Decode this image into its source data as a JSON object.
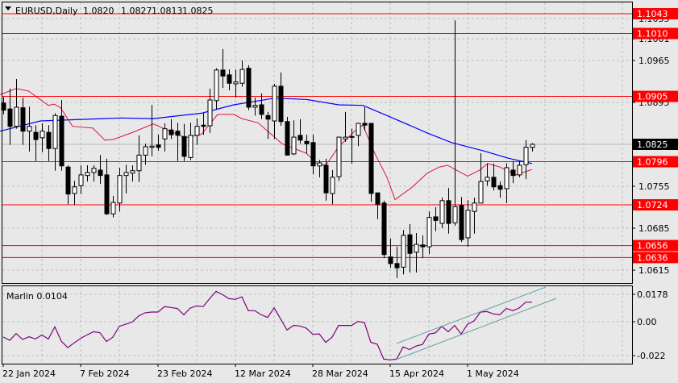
{
  "header": {
    "symbol_label": "EURUSD,Daily",
    "open": "1.0820",
    "high": "1.0827",
    "low": "1.0813",
    "close": "1.0825"
  },
  "indicator": {
    "name_label": "Marlin 0.0104",
    "axis_ticks": [
      "0.0178",
      "0.00",
      "-0.022"
    ]
  },
  "colors": {
    "background": "#e8e8e8",
    "level": "#ff0000",
    "ma_slow": "#0000ff",
    "ma_fast": "#e0143c",
    "marlin": "#800080",
    "channel": "#5f9ea0"
  },
  "price_axis": {
    "ticks": [
      "1.1035",
      "1.1001",
      "1.0965",
      "1.0895",
      "1.0825",
      "1.0755",
      "1.0685",
      "1.0615"
    ],
    "current_price": "1.0825"
  },
  "levels": [
    "1.1043",
    "1.1010",
    "1.0905",
    "1.0796",
    "1.0724",
    "1.0656",
    "1.0636"
  ],
  "date_axis": [
    {
      "label": "22 Jan 2024",
      "bar": 1
    },
    {
      "label": "7 Feb 2024",
      "bar": 13
    },
    {
      "label": "23 Feb 2024",
      "bar": 25
    },
    {
      "label": "12 Mar 2024",
      "bar": 37
    },
    {
      "label": "28 Mar 2024",
      "bar": 49
    },
    {
      "label": "15 Apr 2024",
      "bar": 61
    },
    {
      "label": "1 May 2024",
      "bar": 73
    }
  ],
  "chart_data": {
    "type": "candlestick",
    "symbol": "EURUSD",
    "timeframe": "Daily",
    "ylim": [
      1.0595,
      1.106
    ],
    "ohlc": [
      [
        1.0894,
        1.0904,
        1.0875,
        1.0882
      ],
      [
        1.0884,
        1.0918,
        1.0824,
        1.0855
      ],
      [
        1.0855,
        1.0934,
        1.0851,
        1.0887
      ],
      [
        1.0886,
        1.0903,
        1.0824,
        1.0847
      ],
      [
        1.0847,
        1.0888,
        1.0813,
        1.0855
      ],
      [
        1.0845,
        1.0857,
        1.0797,
        1.0833
      ],
      [
        1.0836,
        1.086,
        1.0812,
        1.0847
      ],
      [
        1.0845,
        1.0857,
        1.0797,
        1.0818
      ],
      [
        1.0818,
        1.0877,
        1.0781,
        1.0873
      ],
      [
        1.0872,
        1.0899,
        1.0781,
        1.0789
      ],
      [
        1.0787,
        1.079,
        1.0725,
        1.0742
      ],
      [
        1.0743,
        1.0764,
        1.0724,
        1.0754
      ],
      [
        1.0756,
        1.079,
        1.0742,
        1.0774
      ],
      [
        1.0773,
        1.079,
        1.0763,
        1.0778
      ],
      [
        1.0778,
        1.079,
        1.0763,
        1.0785
      ],
      [
        1.0782,
        1.0807,
        1.0759,
        1.0773
      ],
      [
        1.0774,
        1.0801,
        1.0707,
        1.0709
      ],
      [
        1.0709,
        1.0739,
        1.0703,
        1.0728
      ],
      [
        1.0727,
        1.0786,
        1.0713,
        1.0773
      ],
      [
        1.0773,
        1.0791,
        1.0743,
        1.0778
      ],
      [
        1.0777,
        1.079,
        1.0763,
        1.0781
      ],
      [
        1.0781,
        1.084,
        1.0762,
        1.0807
      ],
      [
        1.0807,
        1.0826,
        1.0791,
        1.0821
      ],
      [
        1.082,
        1.0891,
        1.0805,
        1.0822
      ],
      [
        1.0824,
        1.0841,
        1.0814,
        1.082
      ],
      [
        1.0834,
        1.086,
        1.0813,
        1.0851
      ],
      [
        1.0849,
        1.0867,
        1.0834,
        1.0841
      ],
      [
        1.0847,
        1.0861,
        1.0797,
        1.084
      ],
      [
        1.0838,
        1.0859,
        1.0797,
        1.0805
      ],
      [
        1.0803,
        1.0861,
        1.0799,
        1.084
      ],
      [
        1.084,
        1.0868,
        1.0824,
        1.0855
      ],
      [
        1.0857,
        1.0877,
        1.0841,
        1.0855
      ],
      [
        1.0856,
        1.0918,
        1.0844,
        1.0899
      ],
      [
        1.0898,
        1.0952,
        1.0883,
        1.0949
      ],
      [
        1.0949,
        1.0984,
        1.0919,
        1.0939
      ],
      [
        1.0941,
        1.095,
        1.0915,
        1.0927
      ],
      [
        1.0926,
        1.095,
        1.0903,
        1.0929
      ],
      [
        1.0927,
        1.0965,
        1.0921,
        1.095
      ],
      [
        1.0952,
        1.0957,
        1.0882,
        1.0887
      ],
      [
        1.0887,
        1.0903,
        1.0873,
        1.089
      ],
      [
        1.0891,
        1.091,
        1.0867,
        1.0875
      ],
      [
        1.0873,
        1.0879,
        1.0834,
        1.0867
      ],
      [
        1.0864,
        1.0926,
        1.0834,
        1.0922
      ],
      [
        1.0922,
        1.0945,
        1.0856,
        1.0863
      ],
      [
        1.0863,
        1.0871,
        1.0807,
        1.0807
      ],
      [
        1.0809,
        1.0865,
        1.0807,
        1.0837
      ],
      [
        1.084,
        1.0867,
        1.0826,
        1.0832
      ],
      [
        1.083,
        1.0841,
        1.081,
        1.0826
      ],
      [
        1.0828,
        1.0841,
        1.0775,
        1.0789
      ],
      [
        1.0789,
        1.0799,
        1.077,
        1.0794
      ],
      [
        1.079,
        1.0801,
        1.0731,
        1.0744
      ],
      [
        1.0743,
        1.0782,
        1.0725,
        1.077
      ],
      [
        1.0771,
        1.0838,
        1.0764,
        1.0837
      ],
      [
        1.0834,
        1.0879,
        1.0829,
        1.0837
      ],
      [
        1.0837,
        1.0851,
        1.0793,
        1.0838
      ],
      [
        1.084,
        1.0861,
        1.0822,
        1.086
      ],
      [
        1.086,
        1.0887,
        1.0848,
        1.0857
      ],
      [
        1.086,
        1.086,
        1.0729,
        1.0743
      ],
      [
        1.0744,
        1.0744,
        1.07,
        1.0725
      ],
      [
        1.0727,
        1.0731,
        1.0635,
        1.0641
      ],
      [
        1.0637,
        1.0668,
        1.0619,
        1.0626
      ],
      [
        1.0626,
        1.0654,
        1.0602,
        1.0619
      ],
      [
        1.062,
        1.0682,
        1.0608,
        1.0673
      ],
      [
        1.0674,
        1.0692,
        1.0611,
        1.0643
      ],
      [
        1.0645,
        1.0677,
        1.0611,
        1.0658
      ],
      [
        1.0657,
        1.0673,
        1.0635,
        1.0654
      ],
      [
        1.0654,
        1.0713,
        1.0642,
        1.0703
      ],
      [
        1.0704,
        1.072,
        1.068,
        1.0698
      ],
      [
        1.0693,
        1.0736,
        1.0685,
        1.0731
      ],
      [
        1.0731,
        1.0752,
        1.0676,
        1.0693
      ],
      [
        1.0694,
        1.1032,
        1.0689,
        1.0721
      ],
      [
        1.0723,
        1.0737,
        1.0662,
        1.0666
      ],
      [
        1.0669,
        1.0732,
        1.0654,
        1.0715
      ],
      [
        1.0713,
        1.0736,
        1.0676,
        1.0727
      ],
      [
        1.0727,
        1.081,
        1.0727,
        1.0763
      ],
      [
        1.0764,
        1.0793,
        1.0756,
        1.077
      ],
      [
        1.077,
        1.0793,
        1.0748,
        1.0754
      ],
      [
        1.0756,
        1.0763,
        1.0736,
        1.075
      ],
      [
        1.0751,
        1.0793,
        1.0727,
        1.0786
      ],
      [
        1.0782,
        1.0797,
        1.076,
        1.0773
      ],
      [
        1.0774,
        1.0797,
        1.077,
        1.079
      ],
      [
        1.0791,
        1.0832,
        1.0767,
        1.082
      ],
      [
        1.082,
        1.0827,
        1.0813,
        1.0825
      ]
    ],
    "ma_slow": [
      [
        0.5,
        1.0847
      ],
      [
        6.75,
        1.0864
      ],
      [
        19.25,
        1.0869
      ],
      [
        24.25,
        1.0868
      ],
      [
        31.75,
        1.0877
      ],
      [
        36.75,
        1.0891
      ],
      [
        43,
        1.0902
      ],
      [
        48,
        1.09
      ],
      [
        53,
        1.0891
      ],
      [
        56.75,
        1.089
      ],
      [
        60.5,
        1.0873
      ],
      [
        66.75,
        1.0844
      ],
      [
        70.5,
        1.0828
      ],
      [
        75.5,
        1.0814
      ],
      [
        79.25,
        1.0802
      ],
      [
        83,
        1.0793
      ]
    ],
    "ma_fast": [
      [
        0.5,
        1.0908
      ],
      [
        3,
        1.0918
      ],
      [
        4.9,
        1.0914
      ],
      [
        8,
        1.089
      ],
      [
        8.9,
        1.0892
      ],
      [
        9.9,
        1.0886
      ],
      [
        11.75,
        1.0855
      ],
      [
        14.9,
        1.0852
      ],
      [
        16.75,
        1.0832
      ],
      [
        18,
        1.0833
      ],
      [
        21.1,
        1.0845
      ],
      [
        24.25,
        1.0859
      ],
      [
        29.25,
        1.0836
      ],
      [
        31.75,
        1.0842
      ],
      [
        34.25,
        1.0875
      ],
      [
        36.75,
        1.0875
      ],
      [
        38,
        1.0868
      ],
      [
        40.5,
        1.0861
      ],
      [
        44.25,
        1.0826
      ],
      [
        48,
        1.081
      ],
      [
        49.9,
        1.079
      ],
      [
        51.1,
        1.0791
      ],
      [
        53,
        1.0821
      ],
      [
        55.5,
        1.0847
      ],
      [
        56.75,
        1.0857
      ],
      [
        58.6,
        1.081
      ],
      [
        60.5,
        1.077
      ],
      [
        61.75,
        1.0733
      ],
      [
        64.25,
        1.0752
      ],
      [
        66.75,
        1.0777
      ],
      [
        68.6,
        1.0787
      ],
      [
        69.9,
        1.079
      ],
      [
        71.75,
        1.0779
      ],
      [
        73,
        1.0772
      ],
      [
        74.9,
        1.0782
      ],
      [
        76.1,
        1.0793
      ],
      [
        78,
        1.0787
      ],
      [
        80.5,
        1.0774
      ],
      [
        83,
        1.0783
      ]
    ],
    "marlin": {
      "ylim": [
        -0.026,
        0.0215
      ],
      "values": [
        -0.0099,
        -0.0121,
        -0.0077,
        -0.0115,
        -0.0098,
        -0.0112,
        -0.0086,
        -0.0112,
        -0.0033,
        -0.0126,
        -0.0168,
        -0.0138,
        -0.0108,
        -0.0086,
        -0.0065,
        -0.0072,
        -0.0129,
        -0.01,
        -0.003,
        -0.0016,
        -0.0002,
        0.0037,
        0.0058,
        0.0063,
        0.0063,
        0.0098,
        0.0093,
        0.0086,
        0.0045,
        0.0089,
        0.0103,
        0.0098,
        0.015,
        0.0197,
        0.0176,
        0.015,
        0.0145,
        0.0162,
        0.0072,
        0.0072,
        0.0045,
        0.0028,
        0.009,
        0.0019,
        -0.0054,
        -0.0024,
        -0.0028,
        -0.0042,
        -0.0082,
        -0.0079,
        -0.0134,
        -0.01,
        -0.0024,
        -0.0024,
        -0.0024,
        0.0002,
        -0.0005,
        -0.0134,
        -0.0146,
        -0.0243,
        -0.0248,
        -0.0243,
        -0.0164,
        -0.0181,
        -0.0158,
        -0.0148,
        -0.008,
        -0.0073,
        -0.003,
        -0.0065,
        -0.0024,
        -0.008,
        -0.0016,
        0.0005,
        0.0063,
        0.0066,
        0.0051,
        0.0045,
        0.0086,
        0.0072,
        0.0089,
        0.0127,
        0.0127
      ],
      "channel": [
        {
          "from": [
            62,
            -0.0141
          ],
          "to": [
            85.1,
            0.0225
          ]
        },
        {
          "from": [
            61.9,
            -0.0246
          ],
          "to": [
            86.75,
            0.0152
          ]
        }
      ]
    }
  }
}
